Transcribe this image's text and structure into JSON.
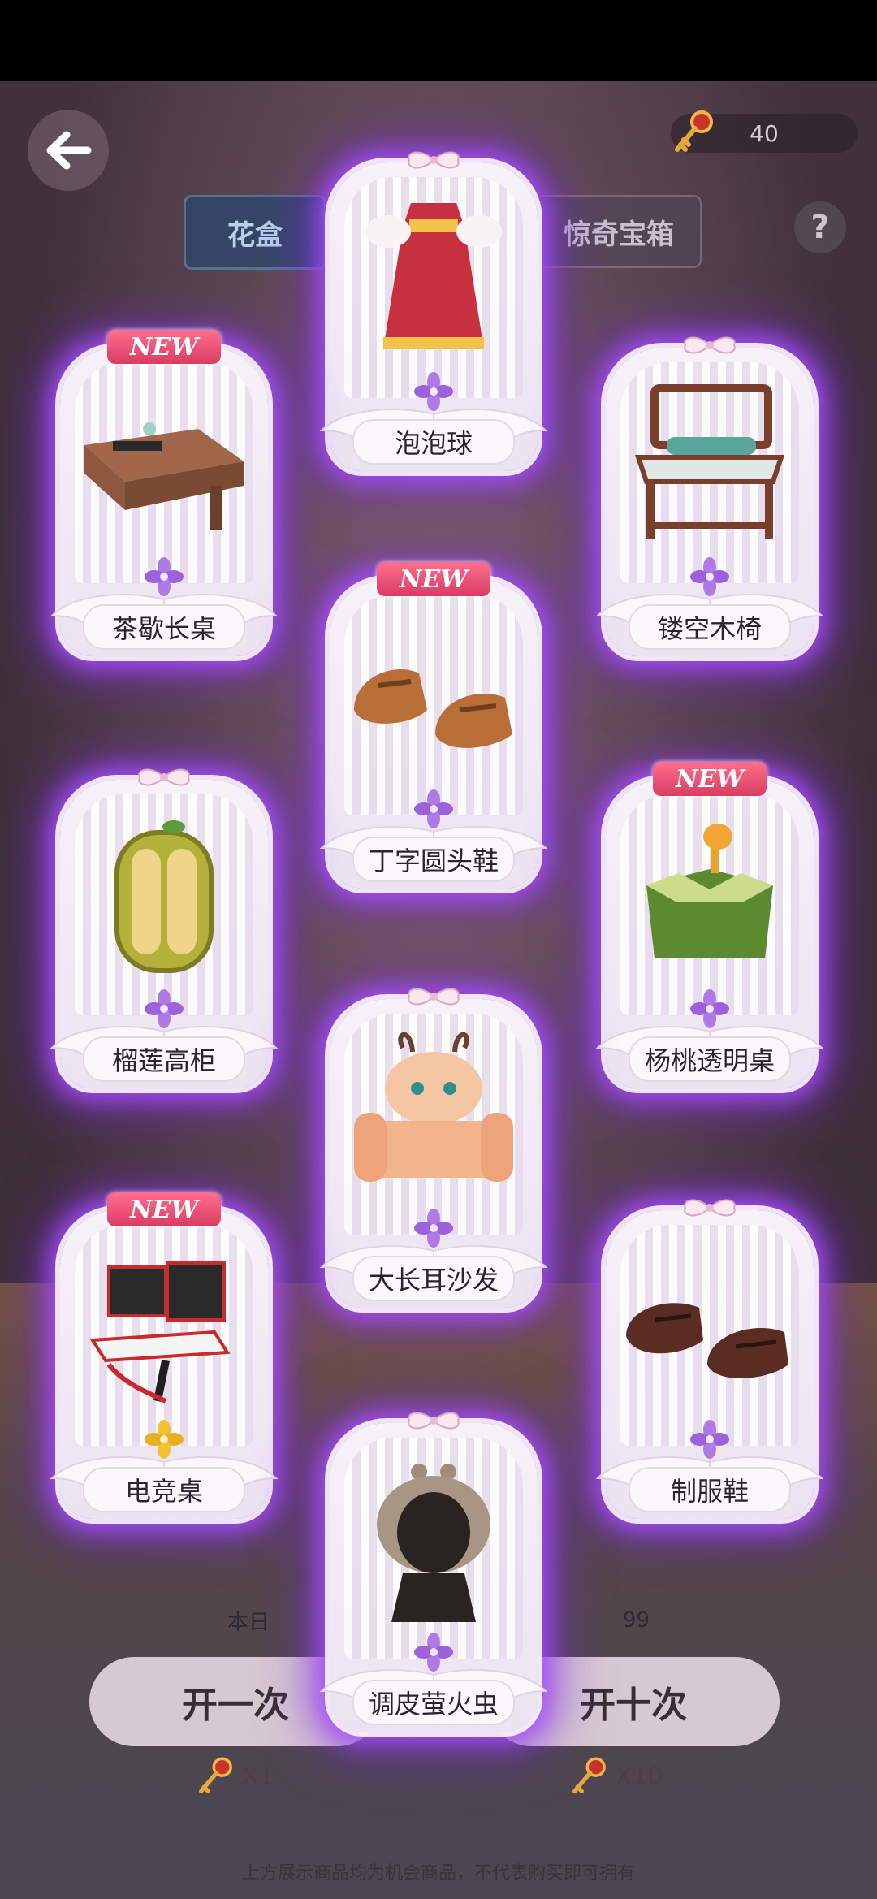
{
  "header": {
    "key_count": "40",
    "help": "?"
  },
  "tabs": [
    "花盒",
    "惊奇宝箱"
  ],
  "cards": [
    {
      "label": "泡泡球",
      "new": "",
      "icon": "dress-icon"
    },
    {
      "label": "茶歇长桌",
      "new": "NEW",
      "icon": "tea-table-icon"
    },
    {
      "label": "镂空木椅",
      "new": "",
      "icon": "wooden-chair-icon"
    },
    {
      "label": "丁字圆头鞋",
      "new": "NEW",
      "icon": "shoes-icon"
    },
    {
      "label": "榴莲高柜",
      "new": "",
      "icon": "durian-cabinet-icon"
    },
    {
      "label": "杨桃透明桌",
      "new": "NEW",
      "icon": "starfruit-table-icon"
    },
    {
      "label": "大长耳沙发",
      "new": "",
      "icon": "sofa-icon"
    },
    {
      "label": "电竞桌",
      "new": "NEW",
      "icon": "gaming-desk-icon"
    },
    {
      "label": "制服鞋",
      "new": "",
      "icon": "loafers-icon"
    },
    {
      "label": "调皮萤火虫",
      "new": "",
      "icon": "hair-icon"
    }
  ],
  "bottom": {
    "daily_left": "本日",
    "daily_right": "99",
    "open_once": "开一次",
    "open_ten": "开十次",
    "cost_once": "X1",
    "cost_ten": "X10",
    "disclaimer": "上方展示商品均为机会商品，不代表购买即可拥有"
  },
  "colors": {
    "glow": "#a850ff",
    "new_badge": "#e0466a",
    "flower": "#b07ae6",
    "gold_flower": "#f2c230"
  }
}
